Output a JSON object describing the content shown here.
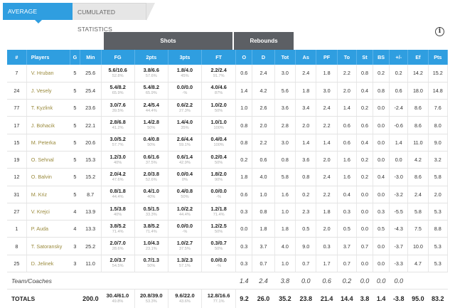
{
  "tabs": {
    "average": "AVERAGE STATISTICS",
    "cumulated": "CUMULATED STATISTICS"
  },
  "info_icon": "i",
  "groups": {
    "shots": "Shots",
    "rebounds": "Rebounds"
  },
  "columns": [
    "#",
    "Players",
    "G",
    "Min",
    "FG",
    "2pts",
    "3pts",
    "FT",
    "O",
    "D",
    "Tot",
    "As",
    "PF",
    "To",
    "St",
    "BS",
    "+/-",
    "Ef",
    "Pts"
  ],
  "players": [
    {
      "num": "7",
      "name": "V. Hruban",
      "g": "5",
      "min": "25.6",
      "fg": "5.6/10.6",
      "fgp": "52.8%",
      "p2": "3.8/6.6",
      "p2p": "57.6%",
      "p3": "1.8/4.0",
      "p3p": "45%",
      "ft": "2.2/2.4",
      "ftp": "91.7%",
      "o": "0.6",
      "d": "2.4",
      "tot": "3.0",
      "as": "2.4",
      "pf": "1.8",
      "to": "2.2",
      "st": "0.8",
      "bs": "0.2",
      "pm": "0.2",
      "ef": "14.2",
      "pts": "15.2"
    },
    {
      "num": "24",
      "name": "J. Vesely",
      "g": "5",
      "min": "25.4",
      "fg": "5.4/8.2",
      "fgp": "65.9%",
      "p2": "5.4/8.2",
      "p2p": "65.9%",
      "p3": "0.0/0.0",
      "p3p": "-%",
      "ft": "4.0/4.6",
      "ftp": "87%",
      "o": "1.4",
      "d": "4.2",
      "tot": "5.6",
      "as": "1.8",
      "pf": "3.0",
      "to": "2.0",
      "st": "0.4",
      "bs": "0.8",
      "pm": "0.6",
      "ef": "18.0",
      "pts": "14.8"
    },
    {
      "num": "77",
      "name": "T. Kyzlink",
      "g": "5",
      "min": "23.6",
      "fg": "3.0/7.6",
      "fgp": "39.5%",
      "p2": "2.4/5.4",
      "p2p": "44.4%",
      "p3": "0.6/2.2",
      "p3p": "27.3%",
      "ft": "1.0/2.0",
      "ftp": "50%",
      "o": "1.0",
      "d": "2.6",
      "tot": "3.6",
      "as": "3.4",
      "pf": "2.4",
      "to": "1.4",
      "st": "0.2",
      "bs": "0.0",
      "pm": "-2.4",
      "ef": "8.6",
      "pts": "7.6"
    },
    {
      "num": "17",
      "name": "J. Bohacik",
      "g": "5",
      "min": "22.1",
      "fg": "2.8/6.8",
      "fgp": "41.2%",
      "p2": "1.4/2.8",
      "p2p": "50%",
      "p3": "1.4/4.0",
      "p3p": "35%",
      "ft": "1.0/1.0",
      "ftp": "100%",
      "o": "0.8",
      "d": "2.0",
      "tot": "2.8",
      "as": "2.0",
      "pf": "2.2",
      "to": "0.6",
      "st": "0.6",
      "bs": "0.0",
      "pm": "-0.6",
      "ef": "8.6",
      "pts": "8.0"
    },
    {
      "num": "15",
      "name": "M. Peterka",
      "g": "5",
      "min": "20.6",
      "fg": "3.0/5.2",
      "fgp": "57.7%",
      "p2": "0.4/0.8",
      "p2p": "50%",
      "p3": "2.6/4.4",
      "p3p": "59.1%",
      "ft": "0.4/0.4",
      "ftp": "100%",
      "o": "0.8",
      "d": "2.2",
      "tot": "3.0",
      "as": "1.4",
      "pf": "1.4",
      "to": "0.6",
      "st": "0.4",
      "bs": "0.0",
      "pm": "1.4",
      "ef": "11.0",
      "pts": "9.0"
    },
    {
      "num": "19",
      "name": "O. Sehnal",
      "g": "5",
      "min": "15.3",
      "fg": "1.2/3.0",
      "fgp": "40%",
      "p2": "0.6/1.6",
      "p2p": "37.5%",
      "p3": "0.6/1.4",
      "p3p": "42.9%",
      "ft": "0.2/0.4",
      "ftp": "50%",
      "o": "0.2",
      "d": "0.6",
      "tot": "0.8",
      "as": "3.6",
      "pf": "2.0",
      "to": "1.6",
      "st": "0.2",
      "bs": "0.0",
      "pm": "0.0",
      "ef": "4.2",
      "pts": "3.2"
    },
    {
      "num": "12",
      "name": "O. Balvin",
      "g": "5",
      "min": "15.2",
      "fg": "2.0/4.2",
      "fgp": "47.6%",
      "p2": "2.0/3.8",
      "p2p": "52.6%",
      "p3": "0.0/0.4",
      "p3p": "0%",
      "ft": "1.8/2.0",
      "ftp": "90%",
      "o": "1.8",
      "d": "4.0",
      "tot": "5.8",
      "as": "0.8",
      "pf": "2.4",
      "to": "1.6",
      "st": "0.2",
      "bs": "0.4",
      "pm": "-3.0",
      "ef": "8.6",
      "pts": "5.8"
    },
    {
      "num": "31",
      "name": "M. Kriz",
      "g": "5",
      "min": "8.7",
      "fg": "0.8/1.8",
      "fgp": "44.4%",
      "p2": "0.4/1.0",
      "p2p": "40%",
      "p3": "0.4/0.8",
      "p3p": "50%",
      "ft": "0.0/0.0",
      "ftp": "-%",
      "o": "0.6",
      "d": "1.0",
      "tot": "1.6",
      "as": "0.2",
      "pf": "2.2",
      "to": "0.4",
      "st": "0.0",
      "bs": "0.0",
      "pm": "-3.2",
      "ef": "2.4",
      "pts": "2.0"
    },
    {
      "num": "27",
      "name": "V. Krejci",
      "g": "4",
      "min": "13.9",
      "fg": "1.5/3.8",
      "fgp": "40%",
      "p2": "0.5/1.5",
      "p2p": "33.3%",
      "p3": "1.0/2.2",
      "p3p": "44.4%",
      "ft": "1.2/1.8",
      "ftp": "71.4%",
      "o": "0.3",
      "d": "0.8",
      "tot": "1.0",
      "as": "2.3",
      "pf": "1.8",
      "to": "0.3",
      "st": "0.0",
      "bs": "0.3",
      "pm": "-5.5",
      "ef": "5.8",
      "pts": "5.3"
    },
    {
      "num": "1",
      "name": "P. Auda",
      "g": "4",
      "min": "13.3",
      "fg": "3.8/5.2",
      "fgp": "71.4%",
      "p2": "3.8/5.2",
      "p2p": "71.4%",
      "p3": "0.0/0.0",
      "p3p": "-%",
      "ft": "1.2/2.5",
      "ftp": "50%",
      "o": "0.0",
      "d": "1.8",
      "tot": "1.8",
      "as": "0.5",
      "pf": "2.0",
      "to": "0.5",
      "st": "0.0",
      "bs": "0.5",
      "pm": "-4.3",
      "ef": "7.5",
      "pts": "8.8"
    },
    {
      "num": "8",
      "name": "T. Satoransky",
      "g": "3",
      "min": "25.2",
      "fg": "2.0/7.0",
      "fgp": "28.6%",
      "p2": "1.0/4.3",
      "p2p": "23.1%",
      "p3": "1.0/2.7",
      "p3p": "37.5%",
      "ft": "0.3/0.7",
      "ftp": "50%",
      "o": "0.3",
      "d": "3.7",
      "tot": "4.0",
      "as": "9.0",
      "pf": "0.3",
      "to": "3.7",
      "st": "0.7",
      "bs": "0.0",
      "pm": "-3.7",
      "ef": "10.0",
      "pts": "5.3"
    },
    {
      "num": "25",
      "name": "D. Jelinek",
      "g": "3",
      "min": "11.0",
      "fg": "2.0/3.7",
      "fgp": "54.5%",
      "p2": "0.7/1.3",
      "p2p": "50%",
      "p3": "1.3/2.3",
      "p3p": "57.1%",
      "ft": "0.0/0.0",
      "ftp": "-%",
      "o": "0.3",
      "d": "0.7",
      "tot": "1.0",
      "as": "0.7",
      "pf": "1.7",
      "to": "0.7",
      "st": "0.0",
      "bs": "0.0",
      "pm": "-3.3",
      "ef": "4.7",
      "pts": "5.3"
    }
  ],
  "team": {
    "label": "Team/Coaches",
    "o": "1.4",
    "d": "2.4",
    "tot": "3.8",
    "as": "0.0",
    "pf": "0.6",
    "to": "0.2",
    "st": "0.0",
    "bs": "0.0",
    "pm": "0.0"
  },
  "totals": {
    "label": "TOTALS",
    "min": "200.0",
    "fg": "30.4/61.0",
    "fgp": "49.8%",
    "p2": "20.8/39.0",
    "p2p": "53.3%",
    "p3": "9.6/22.0",
    "p3p": "43.6%",
    "ft": "12.8/16.6",
    "ftp": "77.1%",
    "o": "9.2",
    "d": "26.0",
    "tot": "35.2",
    "as": "23.8",
    "pf": "21.4",
    "to": "14.4",
    "st": "3.8",
    "bs": "1.4",
    "pm": "-3.8",
    "ef": "95.0",
    "pts": "83.2"
  }
}
